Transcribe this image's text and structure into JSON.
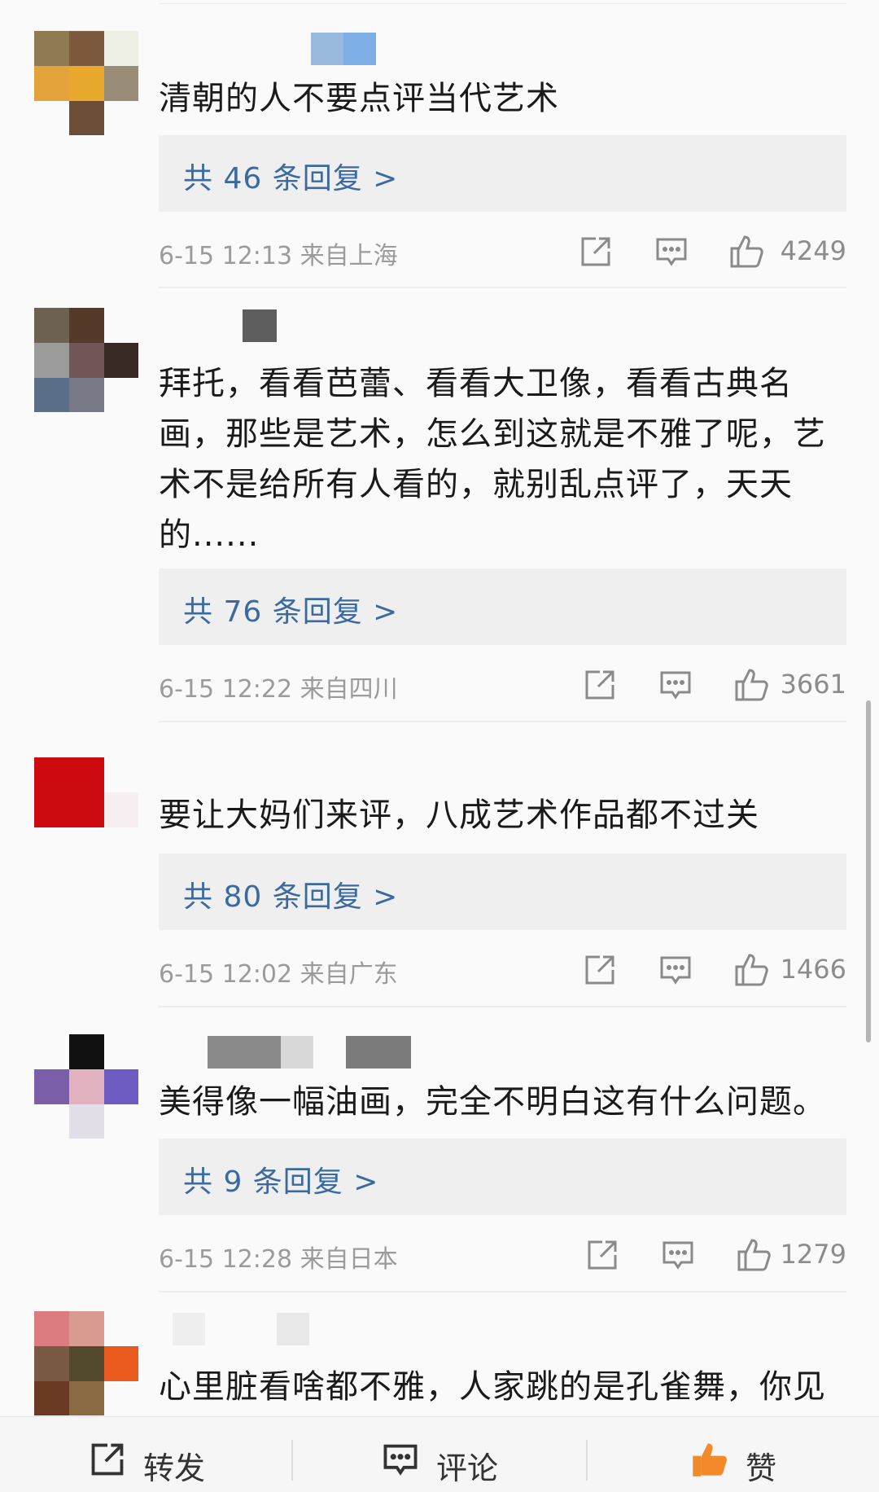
{
  "comments": [
    {
      "text": "清朝的人不要点评当代艺术",
      "replies": "共 46 条回复 >",
      "time": "6-15 12:13 来自上海",
      "likes": "4249"
    },
    {
      "text": "拜托，看看芭蕾、看看大卫像，看看古典名\n画，那些是艺术，怎么到这就是不雅了呢，艺\n术不是给所有人看的，就别乱点评了，天天\n的......",
      "replies": "共 76 条回复 >",
      "time": "6-15 12:22 来自四川",
      "likes": "3661"
    },
    {
      "text": "要让大妈们来评，八成艺术作品都不过关",
      "replies": "共 80 条回复 >",
      "time": "6-15 12:02 来自广东",
      "likes": "1466"
    },
    {
      "text": "美得像一幅油画，完全不明白这有什么问题。",
      "replies": "共 9 条回复 >",
      "time": "6-15 12:28 来自日本",
      "likes": "1279"
    },
    {
      "text": "心里脏看啥都不雅，人家跳的是孔雀舞，你见"
    }
  ],
  "bottom_bar": {
    "repost": "转发",
    "comment": "评论",
    "like": "赞"
  },
  "icons": {
    "share": "share-icon",
    "comment": "comment-icon",
    "like": "thumbs-up-icon"
  },
  "colors": {
    "link_blue": "#3b6aa0",
    "like_orange": "#f28a2c"
  }
}
